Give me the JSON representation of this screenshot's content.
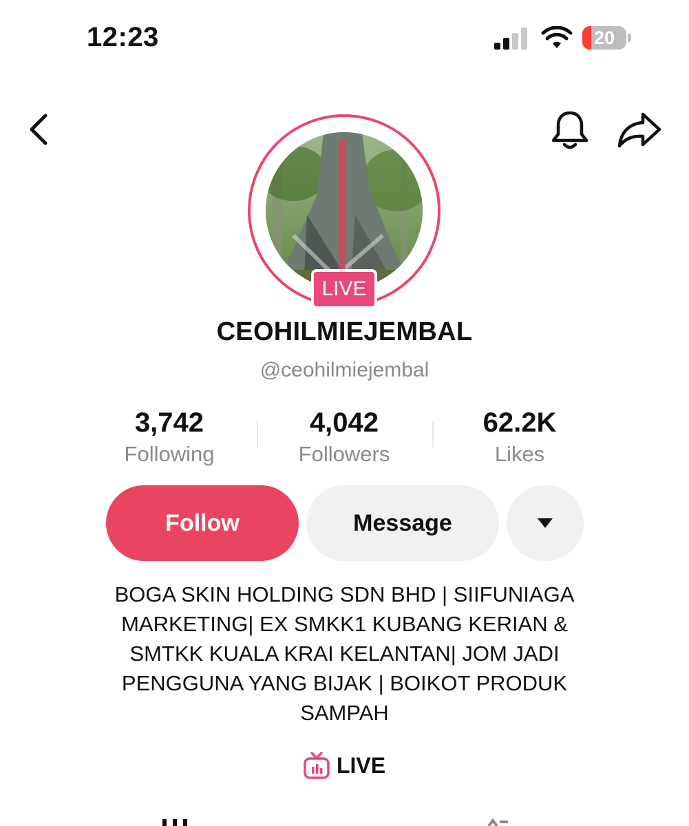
{
  "status_bar": {
    "time": "12:23",
    "battery_level": "20",
    "battery_color": "#ff3b30",
    "icons": [
      "signal-icon",
      "wifi-icon",
      "battery-icon"
    ]
  },
  "nav": {
    "icons": [
      "back-arrow-icon",
      "bell-icon",
      "share-arrow-icon"
    ]
  },
  "profile": {
    "live_badge": "LIVE",
    "display_name": "CEOHILMIEJEMBAL",
    "username": "@ceohilmiejembal",
    "stats": [
      {
        "value": "3,742",
        "label": "Following"
      },
      {
        "value": "4,042",
        "label": "Followers"
      },
      {
        "value": "62.2K",
        "label": "Likes"
      }
    ],
    "bio_lines": [
      "BOGA SKIN HOLDING SDN BHD | SIIFUNIAGA",
      "MARKETING| EX SMKK1 KUBANG KERIAN &",
      "SMTKK KUALA KRAI KELANTAN| JOM JADI",
      "PENGGUNA YANG BIJAK | BOIKOT PRODUK",
      "SAMPAH"
    ],
    "live_link": "LIVE"
  },
  "actions": {
    "follow": "Follow",
    "message": "Message",
    "more_icon": "caret-down-icon"
  },
  "colors": {
    "accent": "#ea4560",
    "live_pink": "#e8487a",
    "muted_text": "#8a8a8a",
    "button_gray": "#f1f1f2"
  }
}
